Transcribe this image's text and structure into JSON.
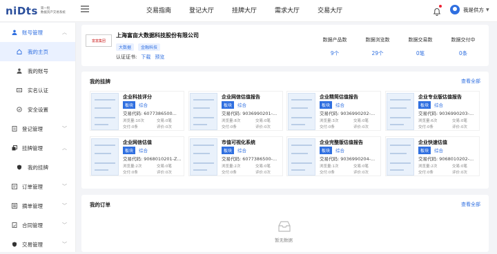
{
  "header": {
    "logo_text": "niDts",
    "logo_sub1": "第一批",
    "logo_sub2": "数据资产交易系统",
    "nav": [
      "交易指南",
      "登记大厅",
      "挂牌大厅",
      "需求大厅",
      "交易大厅"
    ],
    "user_name": "我是供方"
  },
  "sidebar": {
    "items": [
      {
        "label": "账号管理",
        "type": "group"
      },
      {
        "label": "我的主页",
        "type": "sub-active"
      },
      {
        "label": "我的账号",
        "type": "sub"
      },
      {
        "label": "实名认证",
        "type": "sub"
      },
      {
        "label": "安全设置",
        "type": "sub"
      },
      {
        "label": "登记管理",
        "type": "item"
      },
      {
        "label": "挂牌管理",
        "type": "group-open"
      },
      {
        "label": "我的挂牌",
        "type": "sub"
      },
      {
        "label": "订单管理",
        "type": "item"
      },
      {
        "label": "摘单管理",
        "type": "item"
      },
      {
        "label": "合同管理",
        "type": "item"
      },
      {
        "label": "交易管理",
        "type": "item"
      }
    ]
  },
  "company": {
    "logo_text": "富富集团",
    "name": "上海富亩大数据科技股份有限公司",
    "tags": [
      "大数据",
      "金融科技"
    ],
    "cert_label": "认证证书:",
    "cert_download": "下载",
    "cert_preview": "预览",
    "stats": [
      {
        "title": "数据产品数",
        "value": "9个"
      },
      {
        "title": "数据浏览数",
        "value": "29个"
      },
      {
        "title": "数据交易数",
        "value": "0笔"
      },
      {
        "title": "数据交付中",
        "value": "0条"
      }
    ]
  },
  "listings": {
    "title": "我的挂牌",
    "more": "查看全部",
    "items": [
      {
        "name": "企业科技评分",
        "tag1": "板块",
        "tag2": "综合",
        "code": "交易代码: 6077386500...",
        "views": "浏览量:10次",
        "trades": "交易:0笔",
        "delivery": "交付:0条",
        "rating": "评价:0次"
      },
      {
        "name": "企业网信估值报告",
        "tag1": "板块",
        "tag2": "综合",
        "code": "交易代码: 9036990201-...",
        "views": "浏览量:8次",
        "trades": "交易:0笔",
        "delivery": "交付:0条",
        "rating": "评价:0次"
      },
      {
        "name": "企业精简估值报告",
        "tag1": "板块",
        "tag2": "综合",
        "code": "交易代码: 9036990202-...",
        "views": "浏览量:3次",
        "trades": "交易:0笔",
        "delivery": "交付:0条",
        "rating": "评价:0次"
      },
      {
        "name": "企业专业版估值报告",
        "tag1": "板块",
        "tag2": "综合",
        "code": "交易代码: 9036990203-...",
        "views": "浏览量:6次",
        "trades": "交易:0笔",
        "delivery": "交付:0条",
        "rating": "评价:0次"
      },
      {
        "name": "企业网信估值",
        "tag1": "板块",
        "tag2": "综合",
        "code": "交易代码: 9068010201-Z...",
        "views": "浏览量:2次",
        "trades": "交易:0笔",
        "delivery": "交付:0条",
        "rating": "评价:0次"
      },
      {
        "name": "市值可视化系统",
        "tag1": "板块",
        "tag2": "综合",
        "code": "交易代码: 6077386500-...",
        "views": "浏览量:2次",
        "trades": "交易:0笔",
        "delivery": "交付:0条",
        "rating": "评价:0次"
      },
      {
        "name": "企业完整版估值报告",
        "tag1": "板块",
        "tag2": "综合",
        "code": "交易代码: 9036990204-...",
        "views": "浏览量:1次",
        "trades": "交易:0笔",
        "delivery": "交付:0条",
        "rating": "评价:0次"
      },
      {
        "name": "企业快速估值",
        "tag1": "板块",
        "tag2": "综合",
        "code": "交易代码: 9068010202-...",
        "views": "浏览量:2次",
        "trades": "交易:0笔",
        "delivery": "交付:0条",
        "rating": "评价:0次"
      }
    ]
  },
  "orders": {
    "title": "我的订单",
    "more": "查看全部",
    "empty": "暂无数据"
  },
  "colors": {
    "accent": "#2f6fe0",
    "brand": "#2b4f9c"
  }
}
